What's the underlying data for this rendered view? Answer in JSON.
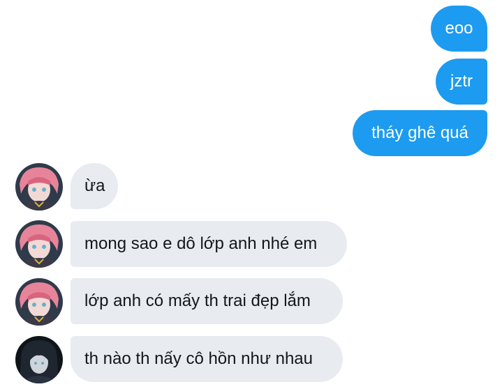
{
  "colors": {
    "sent_bubble": "#1d9bf0",
    "received_bubble": "#e8ebef",
    "sent_text": "#ffffff",
    "received_text": "#14171a"
  },
  "messages": {
    "sent": [
      {
        "text": "eoo"
      },
      {
        "text": "jztr"
      },
      {
        "text": "tháy ghê quá"
      }
    ],
    "received": [
      {
        "text": "ừa",
        "avatar": "pink-hair-anime-avatar-icon"
      },
      {
        "text": "mong sao e dô lớp anh nhé em",
        "avatar": "pink-hair-anime-avatar-icon"
      },
      {
        "text": "lớp anh có mấy th trai đẹp lắm",
        "avatar": "pink-hair-anime-avatar-icon"
      },
      {
        "text": "th nào th nấy cô hồn như nhau",
        "avatar": "dark-hair-anime-avatar-icon"
      }
    ]
  }
}
